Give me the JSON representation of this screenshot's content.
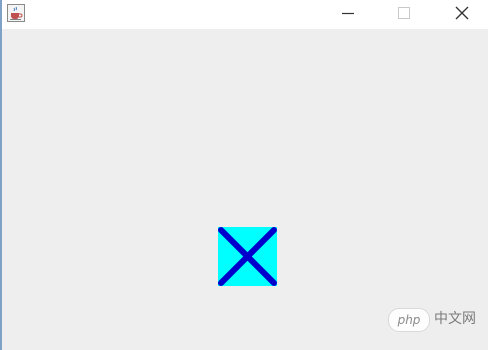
{
  "window": {
    "border_color": "#7ea1c6",
    "background": "#eeeeee",
    "titlebar": {
      "app_icon": "java-coffee-cup-icon",
      "controls": {
        "minimize_icon": "minimize-icon",
        "maximize_icon": "maximize-icon",
        "close_icon": "close-icon"
      }
    }
  },
  "canvas": {
    "shape": {
      "fill": "#00ffff",
      "line_color": "#0000cc"
    }
  },
  "watermark": {
    "badge": "php",
    "text": "中文网"
  }
}
